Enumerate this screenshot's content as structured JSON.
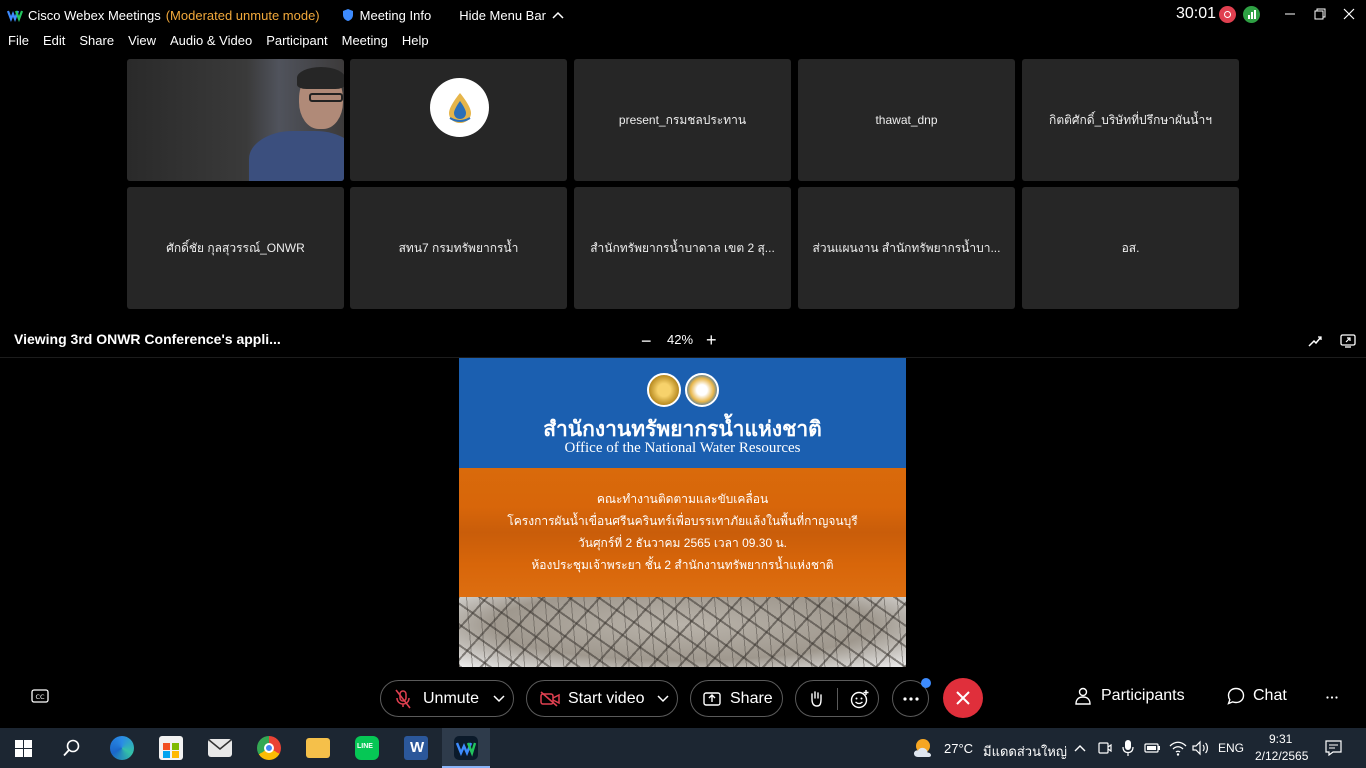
{
  "titlebar": {
    "app_name": "Cisco Webex Meetings",
    "mode": "(Moderated unmute mode)",
    "meeting_info": "Meeting Info",
    "hide_menu": "Hide Menu Bar",
    "timer": "30:01"
  },
  "menu": [
    "File",
    "Edit",
    "Share",
    "View",
    "Audio & Video",
    "Participant",
    "Meeting",
    "Help"
  ],
  "participants": [
    {
      "name": ""
    },
    {
      "name": ""
    },
    {
      "name": "present_กรมชลประทาน"
    },
    {
      "name": "thawat_dnp"
    },
    {
      "name": "กิตติศักดิ์_บริษัทที่ปรึกษาผันน้ำฯ"
    },
    {
      "name": "ศักดิ์ชัย กุลสุวรรณ์_ONWR"
    },
    {
      "name": "สทน7 กรมทรัพยากรน้ำ"
    },
    {
      "name": "สำนักทรัพยากรน้ำบาดาล เขต 2 สุ..."
    },
    {
      "name": "ส่วนแผนงาน สำนักทรัพยากรน้ำบา..."
    },
    {
      "name": "อส."
    }
  ],
  "share": {
    "title": "Viewing 3rd ONWR Conference's appli...",
    "zoom": "42%"
  },
  "slide": {
    "title_th": "สำนักงานทรัพยากรน้ำแห่งชาติ",
    "title_en": "Office of the National Water Resources",
    "lines": [
      "คณะทำงานติดตามและขับเคลื่อน",
      "โครงการผันน้ำเขื่อนศรีนครินทร์เพื่อบรรเทาภัยแล้งในพื้นที่กาญจนบุรี",
      "วันศุกร์ที่ 2 ธันวาคม 2565 เวลา 09.30 น.",
      "ห้องประชุมเจ้าพระยา ชั้น 2 สำนักงานทรัพยากรน้ำแห่งชาติ"
    ]
  },
  "controls": {
    "unmute": "Unmute",
    "start_video": "Start video",
    "share": "Share",
    "participants": "Participants",
    "chat": "Chat"
  },
  "taskbar": {
    "weather": "27°C",
    "weather_desc": "มีแดดส่วนใหญ่",
    "lang": "ENG",
    "time": "9:31",
    "date": "2/12/2565"
  },
  "colors": {
    "accent_orange": "#f2a93b",
    "end_red": "#e02f3b",
    "slide_blue": "#1b5fb0",
    "slide_orange": "#d8660a"
  }
}
